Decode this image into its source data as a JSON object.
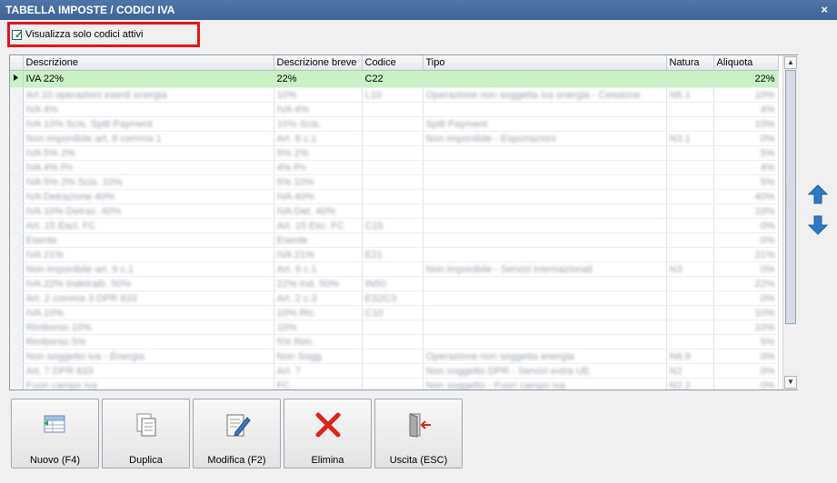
{
  "window": {
    "title": "TABELLA IMPOSTE / CODICI IVA",
    "close_glyph": "×"
  },
  "filter": {
    "label": "Visualizza solo codici attivi",
    "checked": true
  },
  "grid": {
    "headers": [
      "Descrizione",
      "Descrizione breve",
      "Codice",
      "Tipo",
      "Natura",
      "Aliquota"
    ],
    "selected_row": {
      "descrizione": "IVA 22%",
      "breve": "22%",
      "codice": "C22",
      "tipo": "",
      "natura": "",
      "aliquota": "22%"
    },
    "blurred_rows": [
      [
        "Art.10 operazioni esenti energia",
        "10%",
        "L10",
        "Operazione non soggetta iva energia - Cessione",
        "N6.1",
        "10%"
      ],
      [
        "IVA 4%",
        "IVA 4%",
        "",
        "",
        "",
        "4%"
      ],
      [
        "IVA 10% Scis. Split Payment",
        "10% Scis.",
        "",
        "Split Payment",
        "",
        "10%"
      ],
      [
        "Non imponibile art. 8 comma 1",
        "Art. 8 c.1",
        "",
        "Non imponibile - Esportazioni",
        "N3.1",
        "0%"
      ],
      [
        "IVA 5% 2%",
        "5% 2%",
        "",
        "",
        "",
        "5%"
      ],
      [
        "IVA 4% Pn",
        "4% Pn",
        "",
        "",
        "",
        "4%"
      ],
      [
        "IVA 5% 2% Scis. 10%",
        "5% 10%",
        "",
        "",
        "",
        "5%"
      ],
      [
        "IVA Detrazione 40%",
        "IVA 40%",
        "",
        "",
        "",
        "40%"
      ],
      [
        "IVA 10% Detraz. 40%",
        "IVA Det. 40%",
        "",
        "",
        "",
        "10%"
      ],
      [
        "Art. 15 Escl. FC",
        "Art. 15 Esc. FC",
        "C15",
        "",
        "",
        "0%"
      ],
      [
        "Esente",
        "Esente",
        "",
        "",
        "",
        "0%"
      ],
      [
        "IVA 21%",
        "IVA 21%",
        "E21",
        "",
        "",
        "21%"
      ],
      [
        "Non imponibile art. 9 c.1",
        "Art. 9 c.1",
        "",
        "Non imponibile - Servizi internazionali",
        "N3",
        "0%"
      ],
      [
        "IVA 22% Indetraib. 50%",
        "22% Ind. 50%",
        "IN50",
        "",
        "",
        "22%"
      ],
      [
        "Art. 2 comma 3 DPR 633",
        "Art. 2 c.3",
        "ES2C3",
        "",
        "",
        "0%"
      ],
      [
        "IVA 10%",
        "10% Ric.",
        "C10",
        "",
        "",
        "10%"
      ],
      [
        "Rimborso 10%",
        "10%",
        "",
        "",
        "",
        "10%"
      ],
      [
        "Rimborso 5%",
        "5% Rim.",
        "",
        "",
        "",
        "5%"
      ],
      [
        "Non soggetto iva - Energia",
        "Non Sogg.",
        "",
        "Operazione non soggetta energia",
        "N6.9",
        "0%"
      ],
      [
        "Art. 7 DPR 633",
        "Art. 7",
        "",
        "Non soggetto DPR - Servizi extra UE",
        "N2",
        "0%"
      ],
      [
        "Fuori campo iva",
        "FC",
        "",
        "Non soggetto - Fuori campo iva",
        "N2.2",
        "0%"
      ]
    ]
  },
  "sidebar": {
    "move_up_icon": "arrow-up-icon",
    "move_down_icon": "arrow-down-icon"
  },
  "actions": [
    {
      "label": "Nuovo (F4)",
      "icon": "new-record-icon"
    },
    {
      "label": "Duplica",
      "icon": "duplicate-icon"
    },
    {
      "label": "Modifica (F2)",
      "icon": "edit-icon"
    },
    {
      "label": "Elimina",
      "icon": "delete-icon"
    },
    {
      "label": "Uscita (ESC)",
      "icon": "exit-icon"
    }
  ],
  "colors": {
    "selected_row": "#c9f2c3",
    "highlight_frame": "#e4141b",
    "titlebar": "#4a70a3",
    "arrow_blue": "#2e7bc4",
    "delete_red": "#d9241b"
  }
}
